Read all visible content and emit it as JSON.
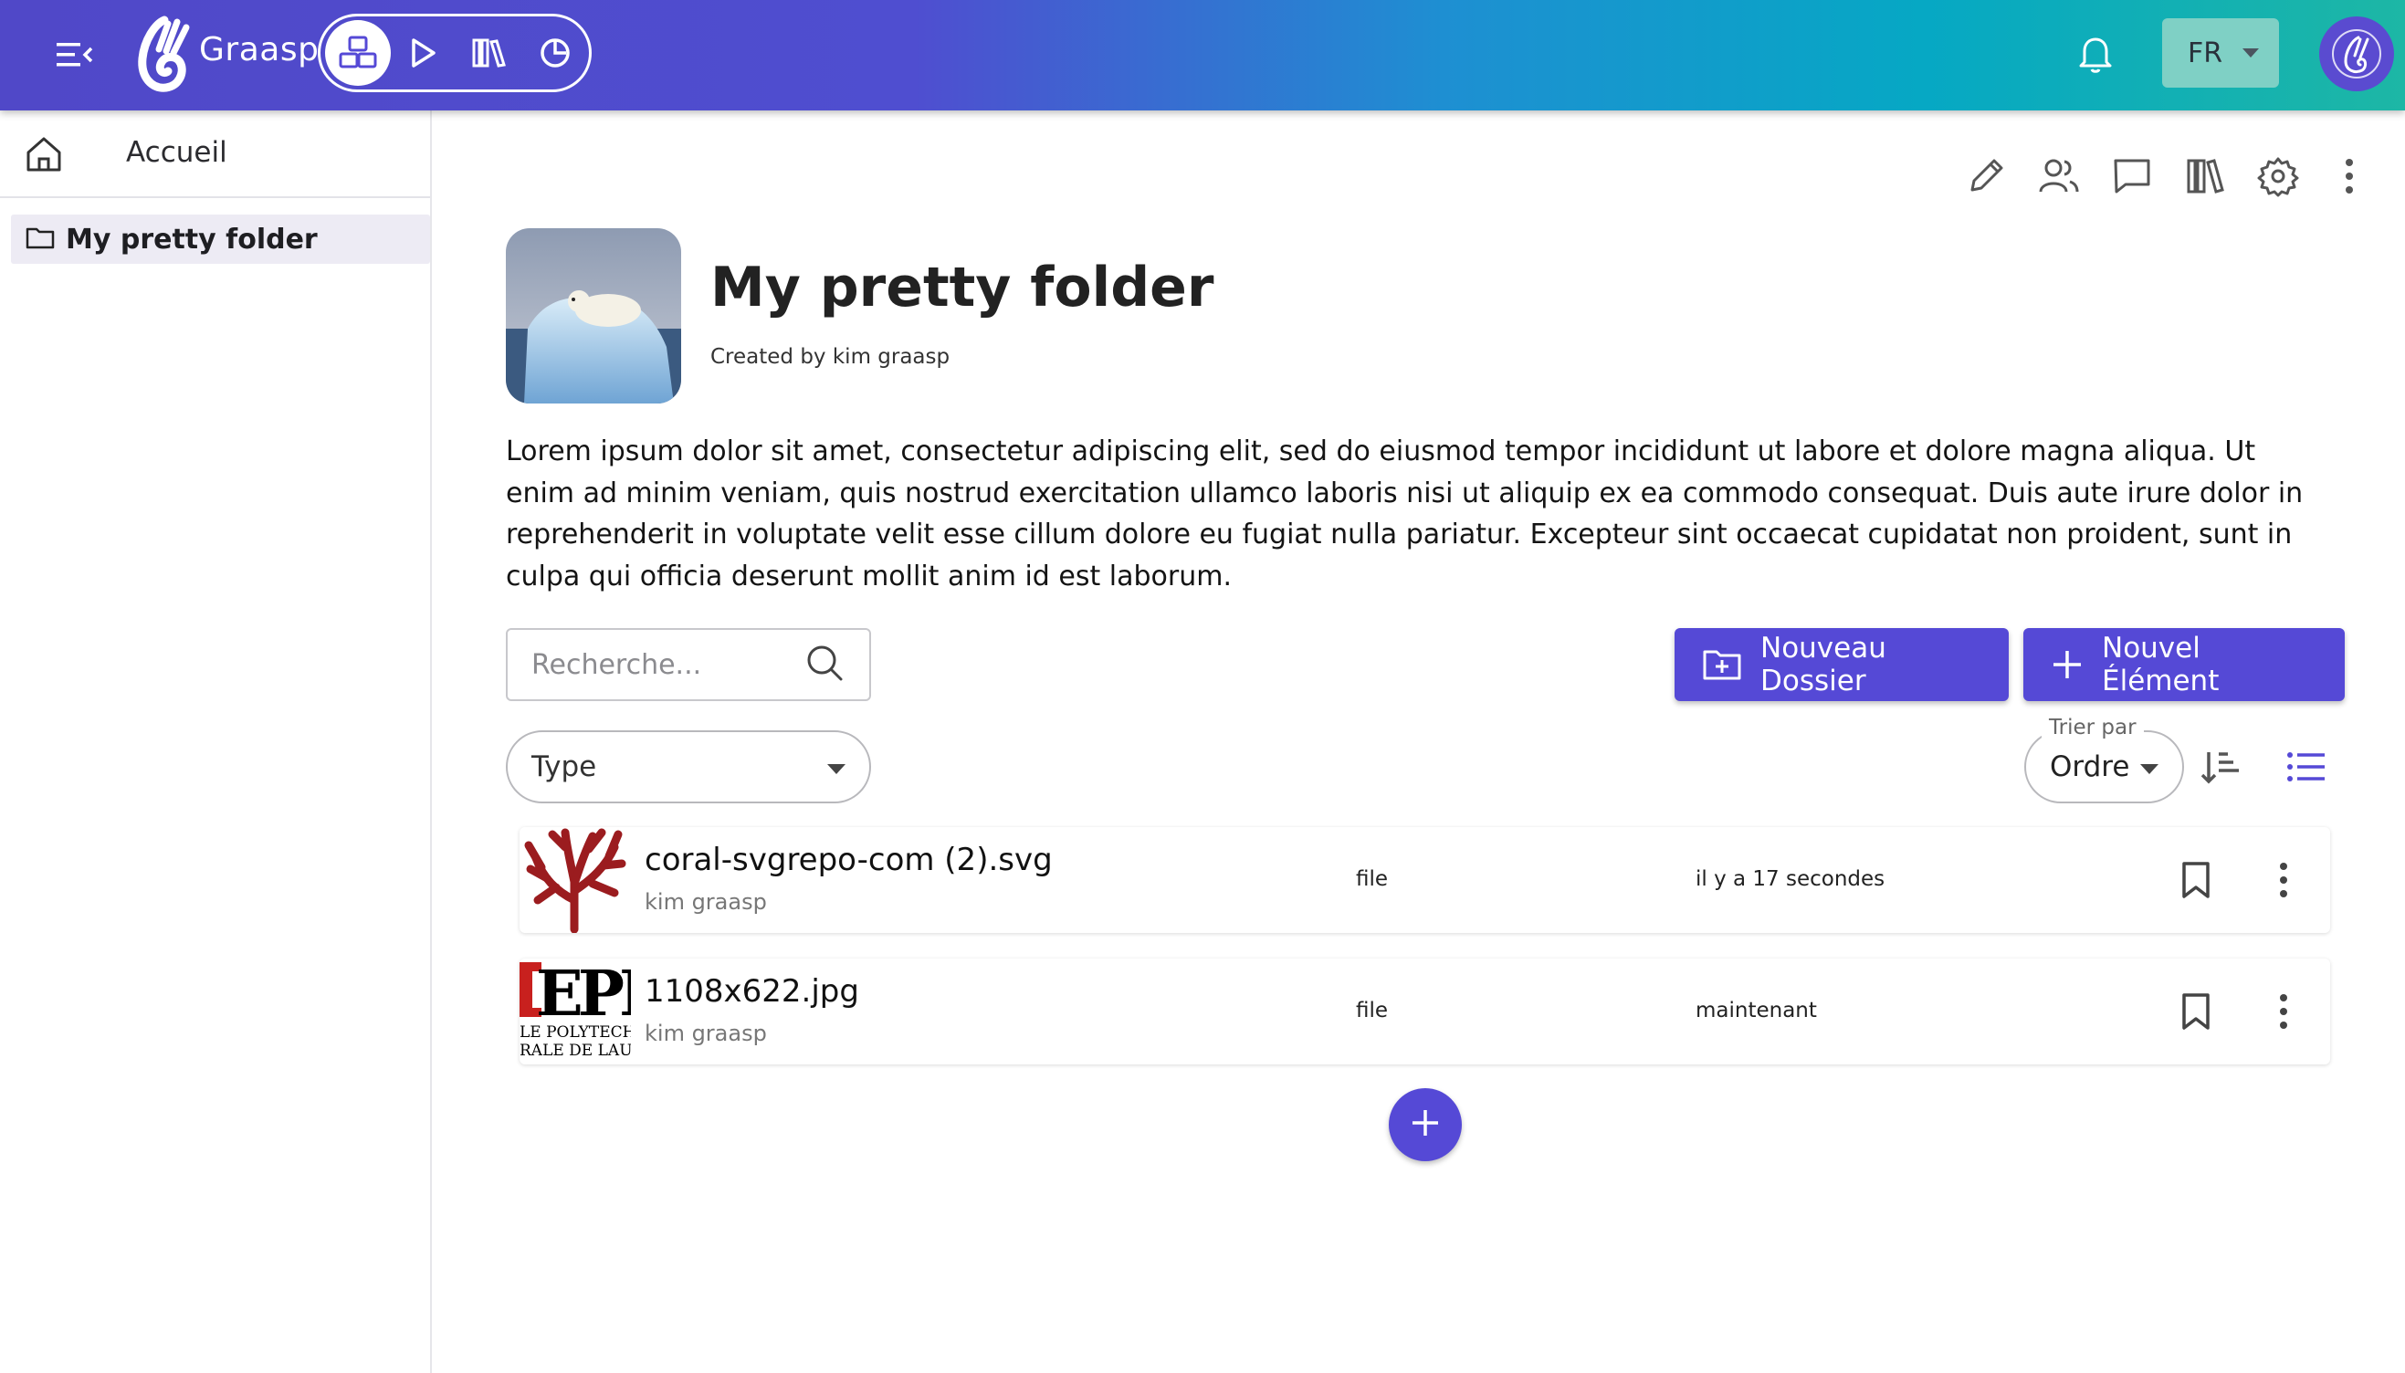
{
  "header": {
    "brand": "Graasp",
    "language": "FR"
  },
  "sidebar": {
    "home_label": "Accueil",
    "tree": [
      {
        "label": "My pretty folder"
      }
    ]
  },
  "folder": {
    "title": "My pretty folder",
    "created_by": "Created by kim graasp",
    "description": "Lorem ipsum dolor sit amet, consectetur adipiscing elit, sed do eiusmod tempor incididunt ut labore et dolore magna aliqua. Ut enim ad minim veniam, quis nostrud exercitation ullamco laboris nisi ut aliquip ex ea commodo consequat. Duis aute irure dolor in reprehenderit in voluptate velit esse cillum dolore eu fugiat nulla pariatur. Excepteur sint occaecat cupidatat non proident, sunt in culpa qui officia deserunt mollit anim id est laborum."
  },
  "search": {
    "placeholder": "Recherche..."
  },
  "actions": {
    "new_folder": "Nouveau Dossier",
    "new_item": "Nouvel Élément"
  },
  "filters": {
    "type_label": "Type",
    "sort_legend": "Trier par",
    "sort_value": "Ordre"
  },
  "items": [
    {
      "name": "coral-svgrepo-com (2).svg",
      "owner": "kim graasp",
      "type": "file",
      "updated": "il y a 17 secondes"
    },
    {
      "name": "1108x622.jpg",
      "owner": "kim graasp",
      "type": "file",
      "updated": "maintenant",
      "thumb_text_1": "LE POLYTECH",
      "thumb_text_2": "RALE DE LAU"
    }
  ],
  "colors": {
    "primary": "#5549d6",
    "header_start": "#5048c8",
    "header_end": "#1db7a5"
  }
}
